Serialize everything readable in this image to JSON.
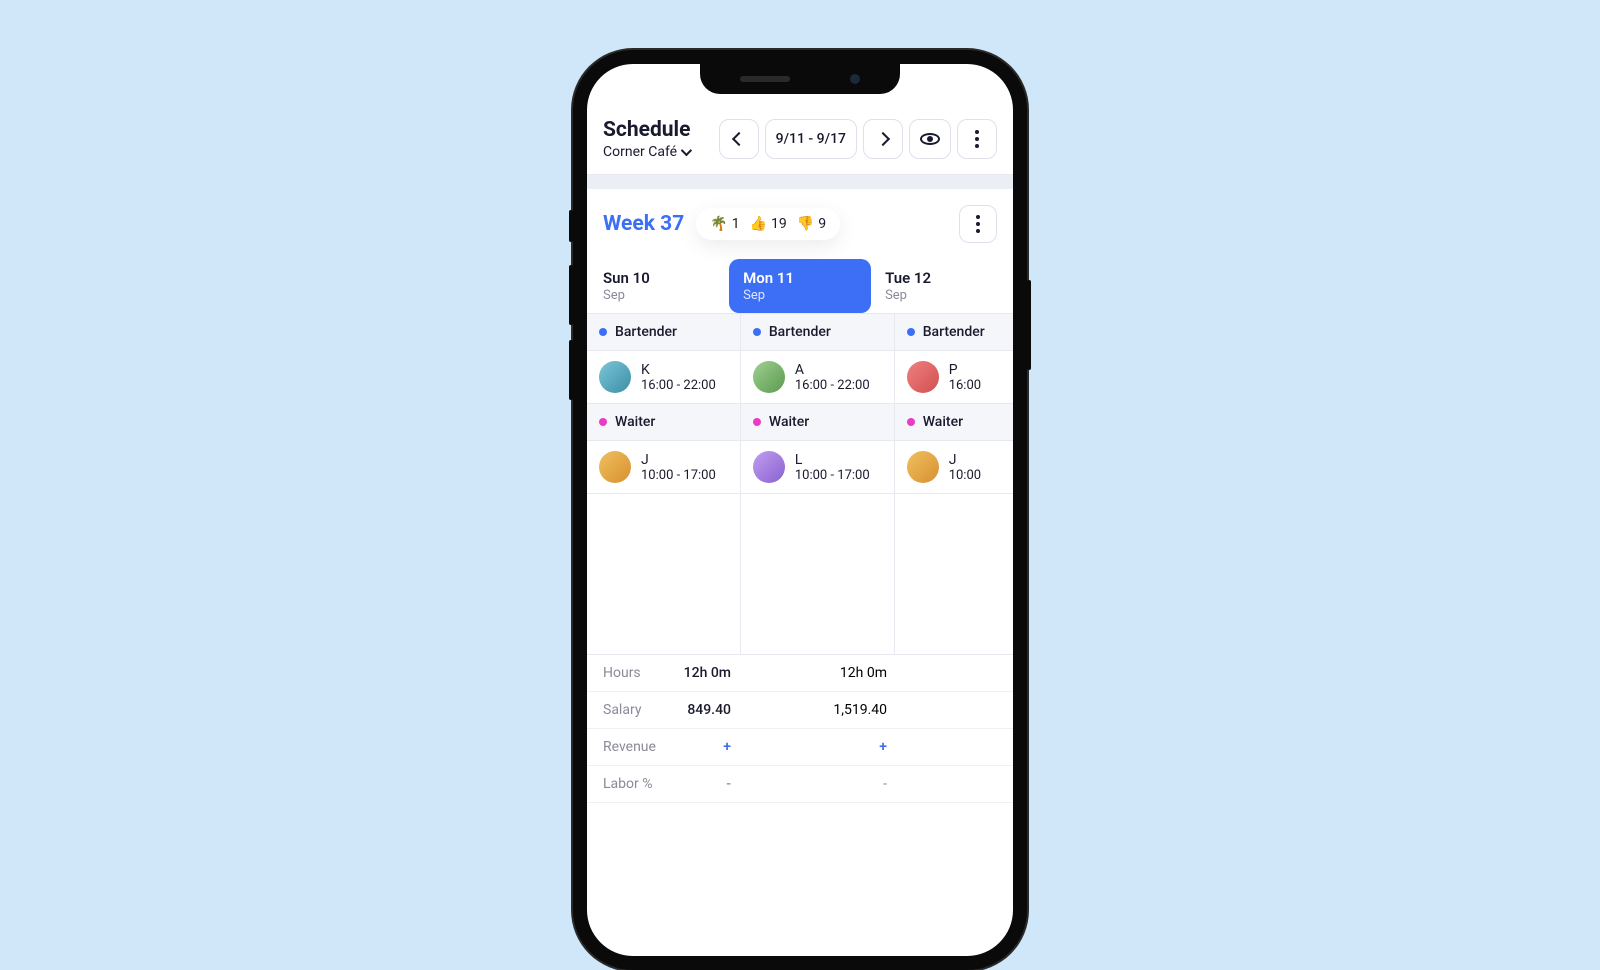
{
  "header": {
    "title": "Schedule",
    "location": "Corner Café",
    "date_range": "9/11 - 9/17"
  },
  "week": {
    "label": "Week 37",
    "stats": [
      {
        "icon": "🌴",
        "count": "1"
      },
      {
        "icon": "👍",
        "count": "19"
      },
      {
        "icon": "👎",
        "count": "9"
      }
    ]
  },
  "days": [
    {
      "name": "Sun 10",
      "month": "Sep",
      "active": false
    },
    {
      "name": "Mon 11",
      "month": "Sep",
      "active": true
    },
    {
      "name": "Tue 12",
      "month": "Sep",
      "active": false
    }
  ],
  "roles": [
    {
      "label": "Bartender",
      "color": "blue"
    },
    {
      "label": "Waiter",
      "color": "pink"
    }
  ],
  "columns": [
    {
      "bartender": {
        "name": "K",
        "time": "16:00 - 22:00"
      },
      "waiter": {
        "name": "J",
        "time": "10:00 - 17:00"
      }
    },
    {
      "bartender": {
        "name": "A",
        "time": "16:00 - 22:00"
      },
      "waiter": {
        "name": "L",
        "time": "10:00 - 17:00"
      }
    },
    {
      "bartender": {
        "name": "P",
        "time": "16:00"
      },
      "waiter": {
        "name": "J",
        "time": "10:00"
      }
    }
  ],
  "kpis": {
    "labels": {
      "hours": "Hours",
      "salary": "Salary",
      "revenue": "Revenue",
      "labor": "Labor %"
    },
    "rows": [
      {
        "hours": "12h 0m",
        "salary": "849.40",
        "revenue": "+",
        "labor": "-"
      },
      {
        "hours": "12h 0m",
        "salary": "1,519.40",
        "revenue": "+",
        "labor": "-"
      }
    ]
  }
}
